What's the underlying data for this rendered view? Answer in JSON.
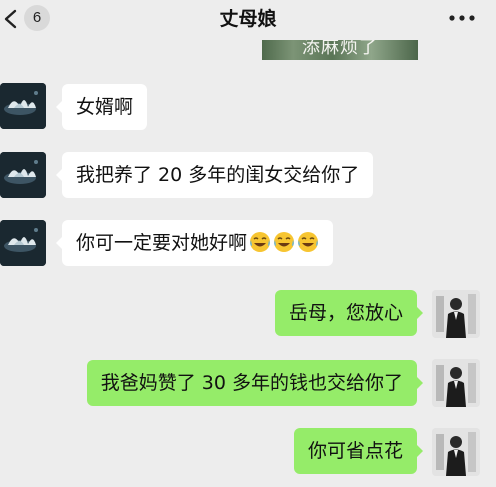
{
  "header": {
    "back_badge": "6",
    "title": "丈母娘",
    "back_icon": "chevron-left-icon",
    "more_icon": "more-dots-icon"
  },
  "image_strip_text": "添麻烦了",
  "messages": [
    {
      "side": "left",
      "text": "女婿啊"
    },
    {
      "side": "left",
      "text": "我把养了 20 多年的闺女交给你了"
    },
    {
      "side": "left",
      "text": "你可一定要对她好啊",
      "emojis": [
        "crying-laughing-emoji",
        "crying-laughing-emoji",
        "crying-laughing-emoji"
      ]
    },
    {
      "side": "right",
      "text": "岳母，您放心"
    },
    {
      "side": "right",
      "text": "我爸妈赞了 30 多年的钱也交给你了"
    },
    {
      "side": "right",
      "text": "你可省点花"
    }
  ],
  "colors": {
    "background": "#ededed",
    "bubble_left": "#ffffff",
    "bubble_right": "#95ec69"
  }
}
